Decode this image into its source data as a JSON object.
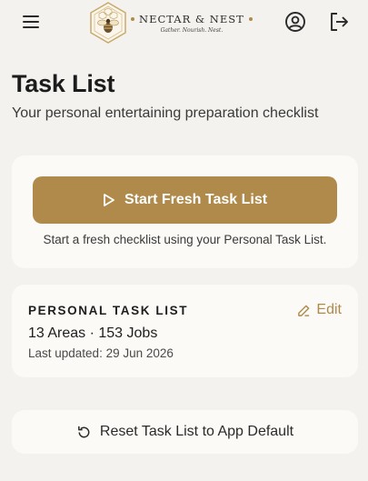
{
  "header": {
    "brand_name": "NECTAR & NEST",
    "tagline": "Gather. Nourish. Nest.",
    "icons": {
      "menu": "hamburger-menu-icon",
      "logo": "honeycomb-bee-logo",
      "account": "user-circle-icon",
      "logout": "logout-icon"
    }
  },
  "page": {
    "title": "Task List",
    "subtitle": "Your personal entertaining preparation checklist"
  },
  "start_card": {
    "button_label": "Start Fresh Task List",
    "button_icon": "play-icon",
    "description": "Start a fresh checklist using your Personal Task List."
  },
  "personal_card": {
    "section_label": "PERSONAL TASK LIST",
    "edit_label": "Edit",
    "edit_icon": "pencil-icon",
    "stats": "13 Areas · 153 Jobs",
    "last_updated": "Last updated: 29 Jun 2026"
  },
  "reset_card": {
    "label": "Reset Task List to App Default",
    "icon": "reset-icon"
  },
  "colors": {
    "accent": "#b08a4a",
    "background": "#f3f2ee",
    "card": "#fbfaf7"
  }
}
